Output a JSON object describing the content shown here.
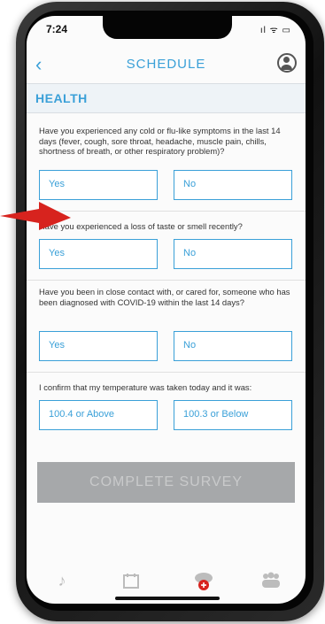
{
  "status": {
    "time": "7:24",
    "icons": "ıl ᯤ ▭"
  },
  "nav": {
    "title": "SCHEDULE",
    "back_icon": "chevron-left-icon",
    "profile_icon": "profile-icon"
  },
  "section": {
    "title": "HEALTH"
  },
  "questions": [
    {
      "text": "Have you experienced any cold or flu-like symptoms in the last 14 days (fever, cough, sore throat, headache, muscle pain, chills, shortness of breath, or other respiratory problem)?",
      "options": [
        "Yes",
        "No"
      ]
    },
    {
      "text": "Have you experienced a loss of taste or smell recently?",
      "options": [
        "Yes",
        "No"
      ]
    },
    {
      "text": "Have you been in close contact with, or cared for, someone who has been diagnosed with COVID-19 within the last 14 days?",
      "options": [
        "Yes",
        "No"
      ]
    },
    {
      "text": "I confirm that my temperature was taken today and it was:",
      "options": [
        "100.4 or Above",
        "100.3 or Below"
      ]
    }
  ],
  "complete_button": "COMPLETE SURVEY",
  "tabs": [
    "music-note-icon",
    "calendar-icon",
    "health-badge-icon",
    "group-icon"
  ],
  "colors": {
    "accent": "#3aa0d8",
    "annotation_arrow": "#d7231e",
    "disabled_button": "#a6a8aa"
  }
}
